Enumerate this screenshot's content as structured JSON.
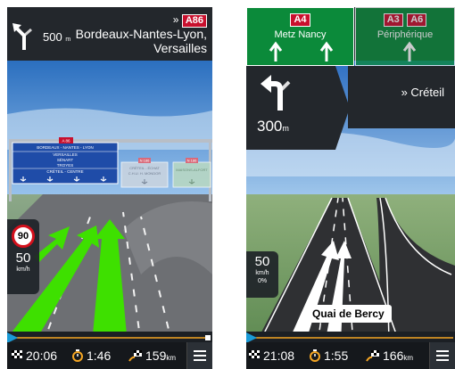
{
  "left": {
    "top_bar": {
      "turn_icon": "fork-left-icon",
      "distance_value": "500",
      "distance_unit": "m",
      "via_prefix": "»",
      "road_badge": "A86",
      "destination": "Bordeaux-Nantes-Lyon, Versailles"
    },
    "gantry": {
      "main_badge": "A 86",
      "main_lines": [
        "BORDEAUX - NANTES - LYON",
        "VERSAILLES",
        "SÉNART",
        "TROYES",
        "CRÉTEIL - CENTRE"
      ],
      "mid_badge": "N 186",
      "mid_lines": [
        "CRÉTEIL - ÉCHAT",
        "C.H.U. H. MONDOR"
      ],
      "right_badge": "N 186",
      "right_lines": [
        "MAISONS-ALFORT"
      ]
    },
    "speed": {
      "limit": "90",
      "current": "50",
      "unit": "km/h"
    },
    "bottom": {
      "eta": "20:06",
      "remaining_time": "1:46",
      "distance": "159",
      "distance_unit": "km"
    },
    "progress_fraction": 0.03
  },
  "right": {
    "signs": [
      {
        "badges": [
          "A4"
        ],
        "text": "Metz Nancy",
        "active": true
      },
      {
        "badges": [
          "A3",
          "A6"
        ],
        "text": "Périphérique",
        "active": false
      }
    ],
    "turn": {
      "icon": "turn-left-icon",
      "distance_value": "300",
      "distance_unit": "m"
    },
    "via": "» Créteil",
    "speed": {
      "current": "50",
      "unit": "km/h",
      "percent": "0%"
    },
    "street": "Quai de Bercy",
    "bottom": {
      "eta": "21:08",
      "remaining_time": "1:55",
      "distance": "166",
      "distance_unit": "km"
    },
    "progress_fraction": 0.03
  },
  "colors": {
    "accent_orange": "#f5a623",
    "sign_green": "#0b8a3a",
    "road_badge_red": "#c8102e",
    "lane_green": "#3ee000"
  }
}
